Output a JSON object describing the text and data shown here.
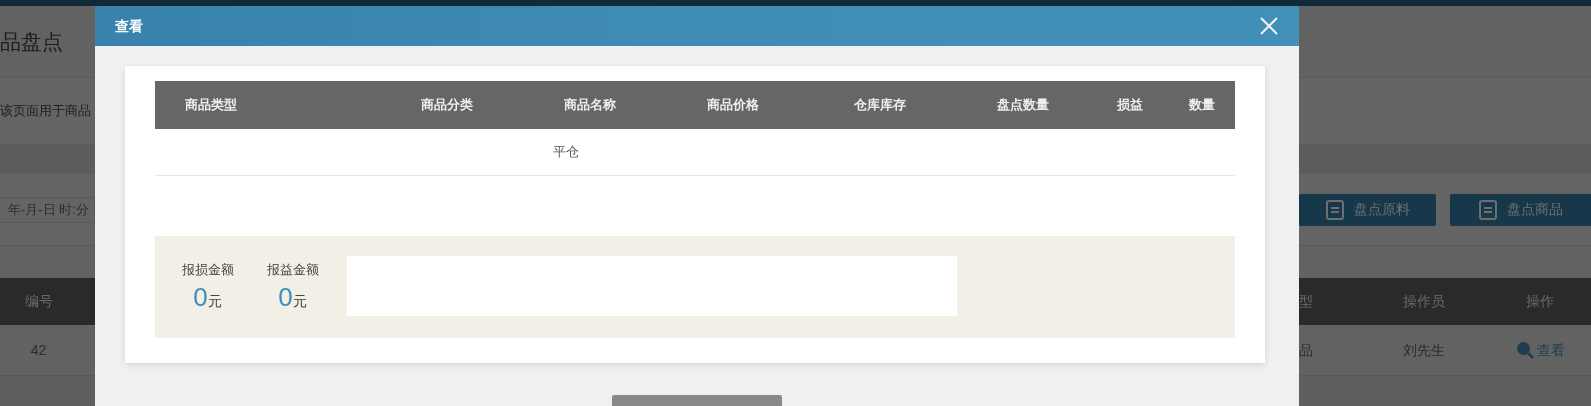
{
  "background_page": {
    "title": "品盘点",
    "description": "该页面用于商品",
    "date_field": {
      "placeholder": "年-月-日 时:分"
    },
    "buttons": [
      {
        "label": "盘点原料"
      },
      {
        "label": "盘点商品"
      }
    ],
    "table": {
      "columns": [
        "编号",
        "型",
        "操作员",
        "操作"
      ],
      "rows": [
        {
          "id": "42",
          "type": "品",
          "operator": "刘先生",
          "action": "查看"
        }
      ]
    }
  },
  "dialog": {
    "title": "查看",
    "table": {
      "columns": [
        "商品类型",
        "商品分类",
        "商品名称",
        "商品价格",
        "仓库库存",
        "盘点数量",
        "损益",
        "数量"
      ],
      "rows": [
        {
          "product_name": "平仓"
        }
      ]
    },
    "summary": [
      {
        "label": "报损金额",
        "value": "0",
        "unit": "元"
      },
      {
        "label": "报益金额",
        "value": "0",
        "unit": "元"
      }
    ]
  }
}
